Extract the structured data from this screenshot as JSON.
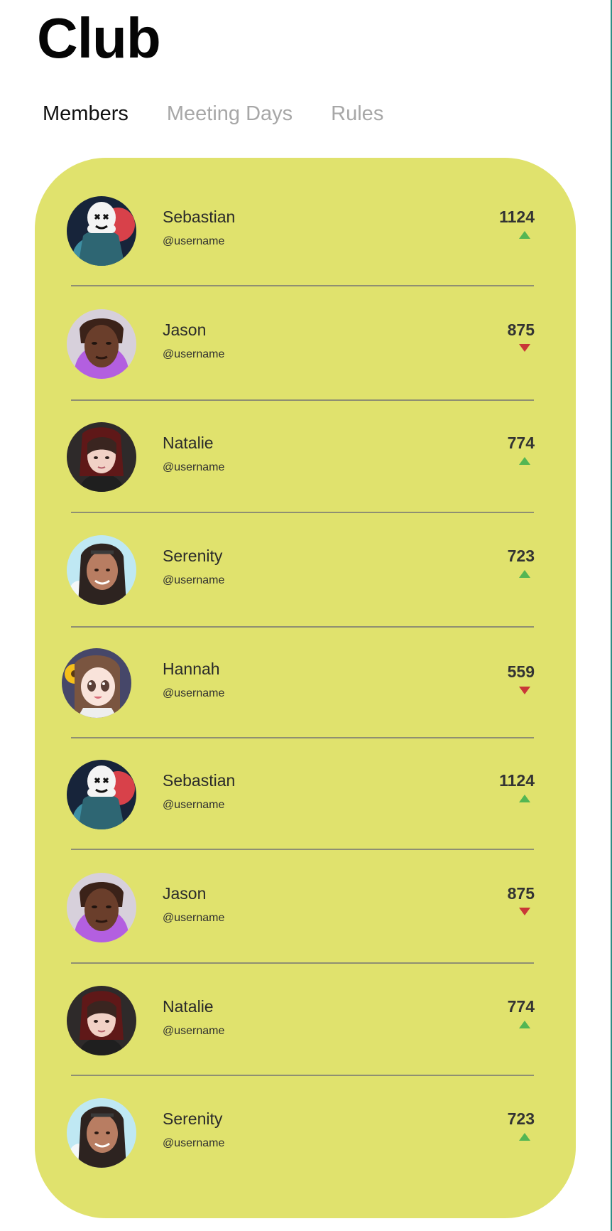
{
  "page": {
    "title": "Club"
  },
  "tabs": [
    {
      "label": "Members",
      "active": true
    },
    {
      "label": "Meeting Days",
      "active": false
    },
    {
      "label": "Rules",
      "active": false
    }
  ],
  "members": [
    {
      "name": "Sebastian",
      "handle": "@username",
      "score": "1124",
      "trend": "up",
      "avatar": "marshmello-avatar"
    },
    {
      "name": "Jason",
      "handle": "@username",
      "score": "875",
      "trend": "down",
      "avatar": "jason-avatar"
    },
    {
      "name": "Natalie",
      "handle": "@username",
      "score": "774",
      "trend": "up",
      "avatar": "natalie-avatar"
    },
    {
      "name": "Serenity",
      "handle": "@username",
      "score": "723",
      "trend": "up",
      "avatar": "serenity-avatar"
    },
    {
      "name": "Hannah",
      "handle": "@username",
      "score": "559",
      "trend": "down",
      "avatar": "hannah-avatar"
    },
    {
      "name": "Sebastian",
      "handle": "@username",
      "score": "1124",
      "trend": "up",
      "avatar": "marshmello-avatar"
    },
    {
      "name": "Jason",
      "handle": "@username",
      "score": "875",
      "trend": "down",
      "avatar": "jason-avatar"
    },
    {
      "name": "Natalie",
      "handle": "@username",
      "score": "774",
      "trend": "up",
      "avatar": "natalie-avatar"
    },
    {
      "name": "Serenity",
      "handle": "@username",
      "score": "723",
      "trend": "up",
      "avatar": "serenity-avatar"
    }
  ],
  "colors": {
    "card": "#e0e26d",
    "up": "#53b653",
    "down": "#c93737",
    "activeTab": "#111111",
    "inactiveTab": "#a7a7a7"
  }
}
